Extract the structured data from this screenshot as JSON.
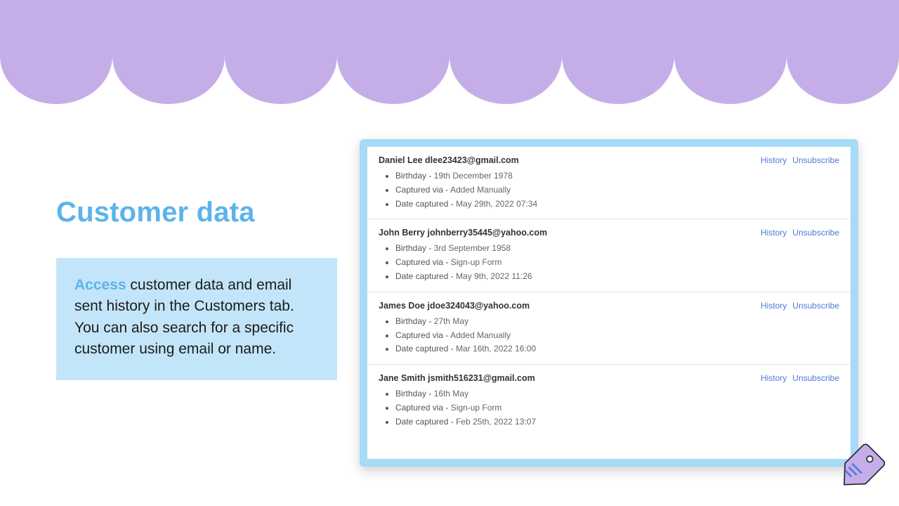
{
  "title": "Customer data",
  "description": {
    "accent": "Access",
    "rest": " customer data and email sent history in the Customers tab. You can also search for a specific customer using email or name."
  },
  "action_labels": {
    "history": "History",
    "unsubscribe": "Unsubscribe"
  },
  "field_labels": {
    "birthday": "Birthday",
    "captured_via": "Captured via",
    "date_captured": "Date captured"
  },
  "customers": [
    {
      "name": "Daniel Lee",
      "email": "dlee23423@gmail.com",
      "birthday": "19th December 1978",
      "captured_via": "Added Manually",
      "date_captured": "May 29th, 2022 07:34"
    },
    {
      "name": "John Berry",
      "email": "johnberry35445@yahoo.com",
      "birthday": "3rd September 1958",
      "captured_via": "Sign-up Form",
      "date_captured": "May 9th, 2022 11:26"
    },
    {
      "name": "James Doe",
      "email": "jdoe324043@yahoo.com",
      "birthday": "27th May",
      "captured_via": "Added Manually",
      "date_captured": "Mar 16th, 2022 16:00"
    },
    {
      "name": "Jane Smith",
      "email": "jsmith516231@gmail.com",
      "birthday": "16th May",
      "captured_via": "Sign-up Form",
      "date_captured": "Feb 25th, 2022 13:07"
    }
  ],
  "colors": {
    "purple": "#c5aee8",
    "blue_accent": "#5bb4eb",
    "panel_border": "#a6daf7",
    "box_bg": "#c3e5fa",
    "link": "#4f79d6"
  }
}
